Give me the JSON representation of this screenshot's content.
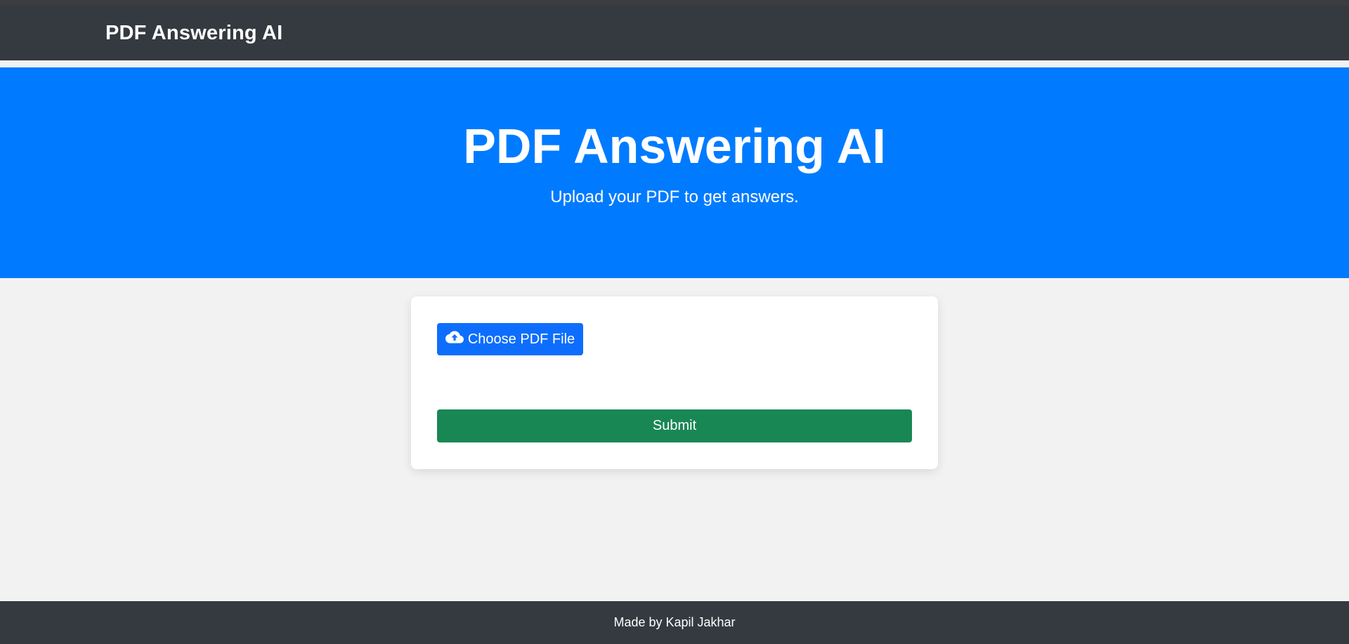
{
  "navbar": {
    "brand": "PDF Answering AI"
  },
  "hero": {
    "title": "PDF Answering AI",
    "subtitle": "Upload your PDF to get answers."
  },
  "upload_card": {
    "choose_button_label": "Choose PDF File",
    "choose_button_icon": "cloud-upload-icon",
    "submit_button_label": "Submit"
  },
  "footer": {
    "text": "Made by Kapil Jakhar"
  },
  "colors": {
    "navbar": "#343a40",
    "hero": "#007bff",
    "primary_button": "#0d6efd",
    "submit_button": "#198754",
    "page_background": "#f2f2f2"
  }
}
